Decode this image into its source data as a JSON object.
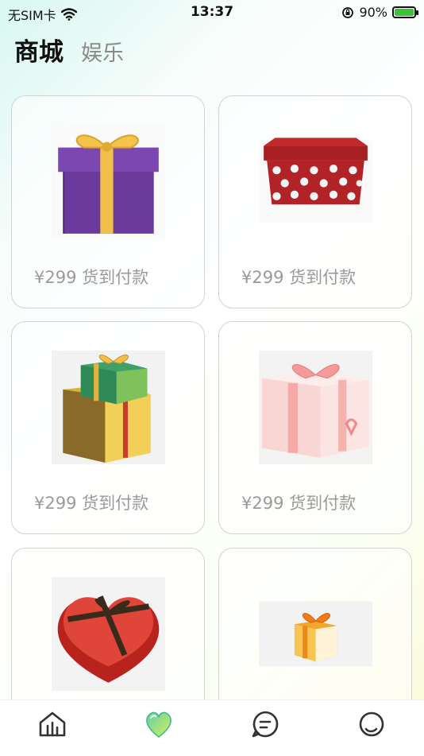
{
  "status_bar": {
    "carrier": "无SIM卡",
    "time": "13:37",
    "battery": "90%",
    "battery_level": 0.9
  },
  "tabs": {
    "active": "商城",
    "inactive": "娱乐"
  },
  "products": [
    {
      "price": "¥299 货到付款",
      "icon": "purple-gift-icon"
    },
    {
      "price": "¥299 货到付款",
      "icon": "red-polka-dot-gift-icon"
    },
    {
      "price": "¥299 货到付款",
      "icon": "stacked-gifts-icon"
    },
    {
      "price": "¥299 货到付款",
      "icon": "pink-gift-icon"
    },
    {
      "price": "",
      "icon": "heart-box-icon"
    },
    {
      "price": "",
      "icon": "small-orange-gift-icon"
    }
  ],
  "bottom_nav": [
    {
      "icon": "home-icon"
    },
    {
      "icon": "heart-icon",
      "active_color": "#5fd1a8"
    },
    {
      "icon": "chat-icon"
    },
    {
      "icon": "profile-icon"
    }
  ]
}
